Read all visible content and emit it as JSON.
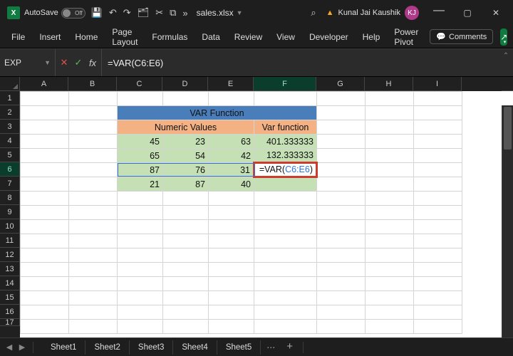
{
  "title": {
    "autosave_label": "AutoSave",
    "autosave_state": "Off",
    "doc_name": "sales.xlsx",
    "search_icon": "⌕",
    "user_name": "Kunal Jai Kaushik",
    "user_initials": "KJ"
  },
  "qat": {
    "save": "💾",
    "undo": "↶",
    "redo": "↷",
    "touch": "🗂",
    "cut": "✂",
    "copy": "⧉",
    "more": "»"
  },
  "window": {
    "min": "—",
    "max": "▢",
    "close": "✕",
    "restore": "⧉"
  },
  "ribbon": {
    "tabs": [
      "File",
      "Insert",
      "Home",
      "Page Layout",
      "Formulas",
      "Data",
      "Review",
      "View",
      "Developer",
      "Help",
      "Power Pivot"
    ],
    "comments": "Comments",
    "share": "↗"
  },
  "fx": {
    "name_box": "EXP",
    "cancel": "✕",
    "enter": "✓",
    "fx": "fx",
    "formula": "=VAR(C6:E6)"
  },
  "columns": [
    "A",
    "B",
    "C",
    "D",
    "E",
    "F",
    "G",
    "H",
    "I"
  ],
  "rows": [
    "1",
    "2",
    "3",
    "4",
    "5",
    "6",
    "7",
    "8",
    "9",
    "10",
    "11",
    "12",
    "13",
    "14",
    "15",
    "16",
    "17"
  ],
  "sheet": {
    "title_row": "VAR Function",
    "sub_left": "Numeric Values",
    "sub_right": "Var function",
    "data": [
      {
        "c": "45",
        "d": "23",
        "e": "63",
        "f": "401.333333"
      },
      {
        "c": "65",
        "d": "54",
        "e": "42",
        "f": "132.333333"
      },
      {
        "c": "87",
        "d": "76",
        "e": "31",
        "f_edit_prefix": "=VAR(",
        "f_edit_ref": "C6:E6",
        "f_edit_suffix": ")"
      },
      {
        "c": "21",
        "d": "87",
        "e": "40",
        "f": ""
      }
    ]
  },
  "tabs": {
    "list": [
      "Sheet1",
      "Sheet2",
      "Sheet3",
      "Sheet4",
      "Sheet5"
    ],
    "more": "⋯",
    "add": "+"
  },
  "nav": {
    "prev": "◀",
    "next": "▶"
  }
}
